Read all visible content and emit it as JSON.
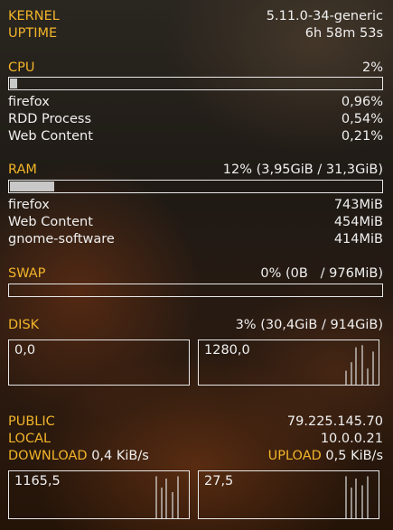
{
  "system": {
    "kernel_label": "KERNEL",
    "kernel_value": "5.11.0-34-generic",
    "uptime_label": "UPTIME",
    "uptime_value": "6h 58m 53s"
  },
  "cpu": {
    "label": "CPU",
    "percent_text": "2%",
    "usage_fraction": 0.02,
    "processes": [
      {
        "name": "firefox",
        "value": "0,96%"
      },
      {
        "name": "RDD Process",
        "value": "0,54%"
      },
      {
        "name": "Web Content",
        "value": "0,21%"
      }
    ]
  },
  "ram": {
    "label": "RAM",
    "summary": "12% (3,95GiB / 31,3GiB)",
    "usage_fraction": 0.12,
    "processes": [
      {
        "name": "firefox",
        "value": "743MiB"
      },
      {
        "name": "Web Content",
        "value": "454MiB"
      },
      {
        "name": "gnome-software",
        "value": "414MiB"
      }
    ]
  },
  "swap": {
    "label": "SWAP",
    "summary": "0% (0B   / 976MiB)",
    "usage_fraction": 0.0
  },
  "disk": {
    "label": "DISK",
    "summary": "3% (30,4GiB / 914GiB)",
    "read_graph": {
      "value": "0,0",
      "spikes": []
    },
    "write_graph": {
      "value": "1280,0",
      "spikes": [
        0.35,
        0.55,
        0.9,
        0.95,
        0.4,
        0.8
      ]
    }
  },
  "network": {
    "public_label": "PUBLIC",
    "public_value": "79.225.145.70",
    "local_label": "LOCAL",
    "local_value": "10.0.0.21",
    "download_label": "DOWNLOAD",
    "download_value": "0,4 KiB/s",
    "upload_label": "UPLOAD",
    "upload_value": "0,5 KiB/s",
    "download_graph": {
      "value": "1165,5",
      "spikes": [
        0.95,
        0.7,
        0.9,
        0.6,
        0.95
      ]
    },
    "upload_graph": {
      "value": "27,5",
      "spikes": [
        0.95,
        0.7,
        0.9,
        0.75,
        0.95
      ]
    }
  }
}
